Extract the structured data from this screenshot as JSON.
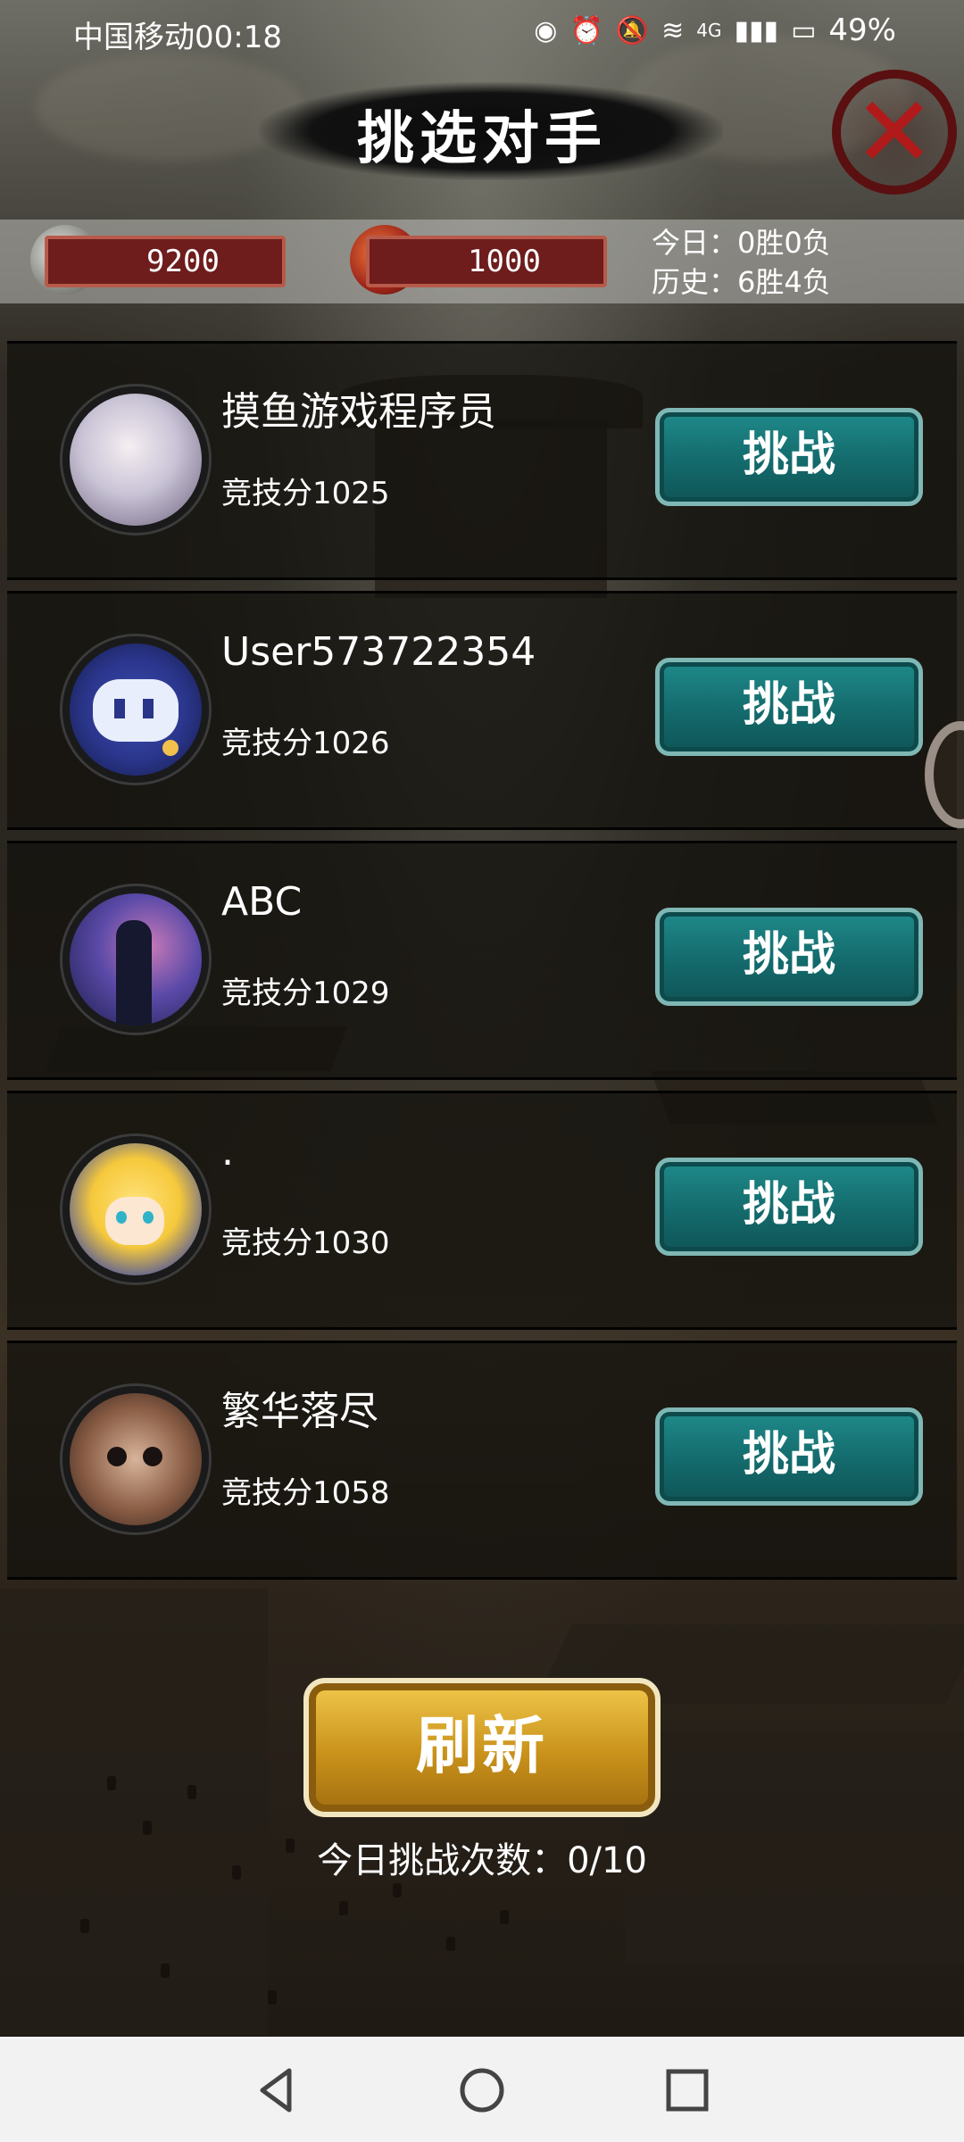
{
  "status_bar": {
    "carrier_time": "中国移动00:18",
    "network": "4G",
    "battery": "49%"
  },
  "header": {
    "title": "挑选对手"
  },
  "resources": {
    "coins": "9200",
    "tokens": "1000",
    "today_record": "今日：0胜0负",
    "history_record": "历史：6胜4负"
  },
  "opponents": [
    {
      "name": "摸鱼游戏程序员",
      "score": "竞技分1025",
      "button": "挑战"
    },
    {
      "name": "User573722354",
      "score": "竞技分1026",
      "button": "挑战"
    },
    {
      "name": "ABC",
      "score": "竞技分1029",
      "button": "挑战"
    },
    {
      "name": ".",
      "score": "竞技分1030",
      "button": "挑战"
    },
    {
      "name": "繁华落尽",
      "score": "竞技分1058",
      "button": "挑战"
    }
  ],
  "footer": {
    "refresh_label": "刷新",
    "challenge_count": "今日挑战次数：0/10"
  },
  "colors": {
    "challenge_button": "#146a6c",
    "refresh_button": "#c9921b",
    "close_red": "#b11a1a"
  }
}
